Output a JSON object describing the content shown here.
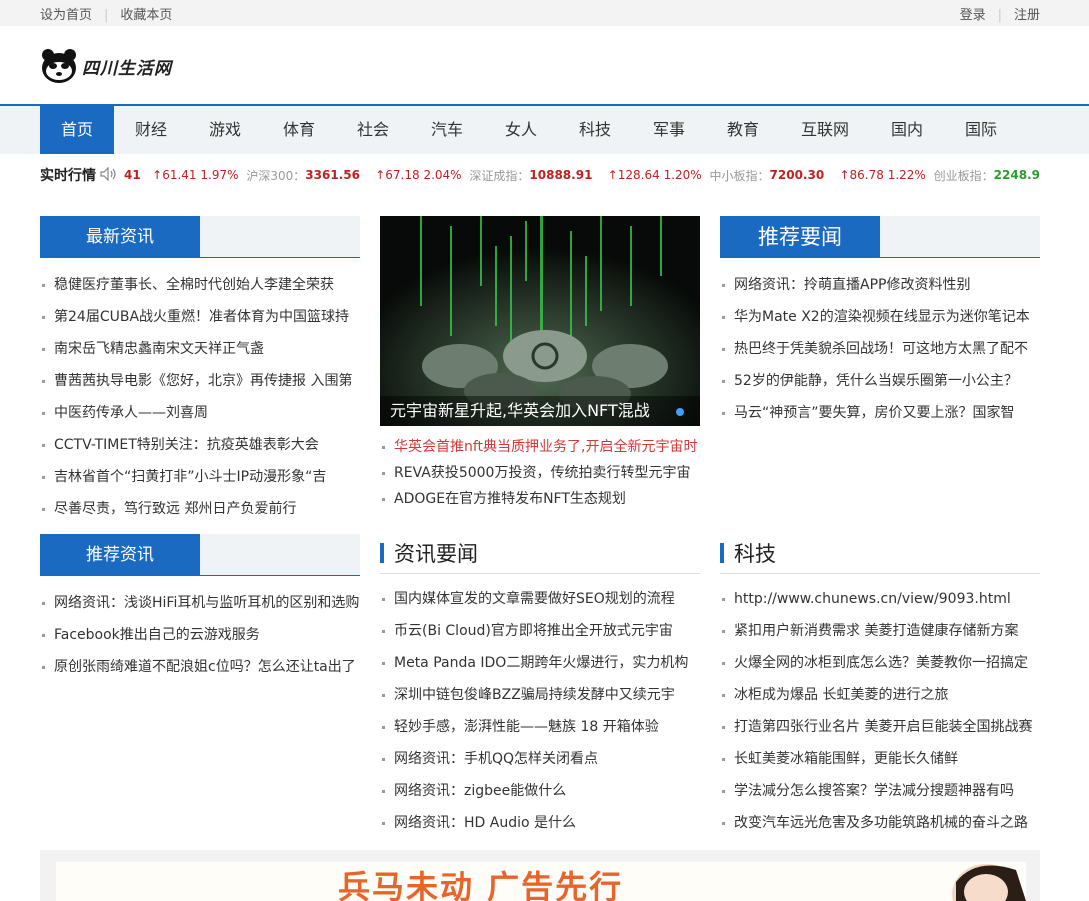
{
  "topbar": {
    "left": [
      "设为首页",
      "收藏本页"
    ],
    "right": [
      "登录",
      "注册"
    ]
  },
  "logo": {
    "text": "四川生活网",
    "icon": "panda-logo-icon"
  },
  "nav": {
    "items": [
      "首页",
      "财经",
      "游戏",
      "体育",
      "社会",
      "汽车",
      "女人",
      "科技",
      "军事",
      "教育",
      "互联网",
      "国内",
      "国际"
    ],
    "active": 0
  },
  "ticker": {
    "label": "实时行情",
    "icon": "speaker-icon",
    "partial_index": {
      "value": "41",
      "change": "↑61.41",
      "pct": "1.97%"
    },
    "hs300": {
      "name": "沪深300：",
      "value": "3361.56",
      "change": "↑67.18",
      "pct": "2.04%"
    },
    "szcz": {
      "name": "深证成指：",
      "value": "10888.91",
      "change": "↑128.64",
      "pct": "1.20%"
    },
    "zxb": {
      "name": "中小板指：",
      "value": "7200.30",
      "change": "↑86.78",
      "pct": "1.22%"
    },
    "cyb": {
      "name": "创业板指：",
      "value": "2248.9"
    }
  },
  "latest": {
    "title": "最新资讯",
    "items": [
      "稳健医疗董事长、全棉时代创始人李建全荣获",
      "第24届CUBA战火重燃！准者体育为中国篮球持",
      "南宋岳飞精忠蠡南宋文天祥正气盏",
      "曹茜茜执导电影《您好，北京》再传捷报 入围第",
      "中医药传承人——刘喜周",
      "CCTV-TIMET特别关注：抗疫英雄表彰大会",
      "吉林省首个“扫黄打非”小斗士IP动漫形象“吉",
      "尽善尽责，笃行致远 郑州日产负爱前行"
    ]
  },
  "recommend_info": {
    "title": "推荐资讯",
    "items": [
      "网络资讯：浅谈HiFi耳机与监听耳机的区别和选购",
      "Facebook推出自己的云游戏服务",
      "原创张雨绮难道不配浪姐c位吗？怎么还让ta出了"
    ]
  },
  "feature": {
    "caption": "元宇宙新星升起,华英会加入NFT混战",
    "items": [
      "华英会首推nft典当质押业务了,开启全新元宇宙时",
      "REVA获投5000万投资，传统拍卖行转型元宇宙",
      "ADOGE在官方推特发布NFT生态规划"
    ]
  },
  "news": {
    "title": "资讯要闻",
    "items": [
      "国内媒体宣发的文章需要做好SEO规划的流程",
      "币云(Bi Cloud)官方即将推出全开放式元宇宙",
      "Meta Panda IDO二期跨年火爆进行，实力机构",
      "深圳中链包俊峰BZZ骗局持续发酵中又续元宇",
      "轻妙手感，澎湃性能——魅族 18 开箱体验",
      "网络资讯：手机QQ怎样关闭看点",
      "网络资讯：zigbee能做什么",
      "网络资讯：HD Audio 是什么"
    ]
  },
  "headlines": {
    "title": "推荐要闻",
    "items": [
      "网络资讯：拎萌直播APP修改资料性别",
      "华为Mate X2的渲染视频在线显示为迷你笔记本",
      "热巴终于凭美貌杀回战场！可这地方太黑了配不",
      "52岁的伊能静，凭什么当娱乐圈第一小公主？",
      "马云“神预言”要失算，房价又要上涨？国家智"
    ]
  },
  "tech": {
    "title": "科技",
    "items": [
      "http://www.chunews.cn/view/9093.html",
      "紧扣用户新消费需求 美菱打造健康存储新方案",
      "火爆全网的冰柜到底怎么选？美菱教你一招搞定",
      "冰柜成为爆品 长虹美菱的进行之旅",
      "打造第四张行业名片 美菱开启巨能装全国挑战赛",
      "长虹美菱冰箱能围鲜，更能长久储鲜",
      "学法减分怎么搜答案？学法减分搜题神器有吗",
      "改变汽车远光危害及多功能筑路机械的奋斗之路"
    ]
  },
  "ad": {
    "text": "兵马未动 广告先行"
  },
  "colors": {
    "brand": "#1a6ac2",
    "up": "#c02020",
    "down": "#2a9d2a",
    "highlight": "#d23a3a"
  }
}
